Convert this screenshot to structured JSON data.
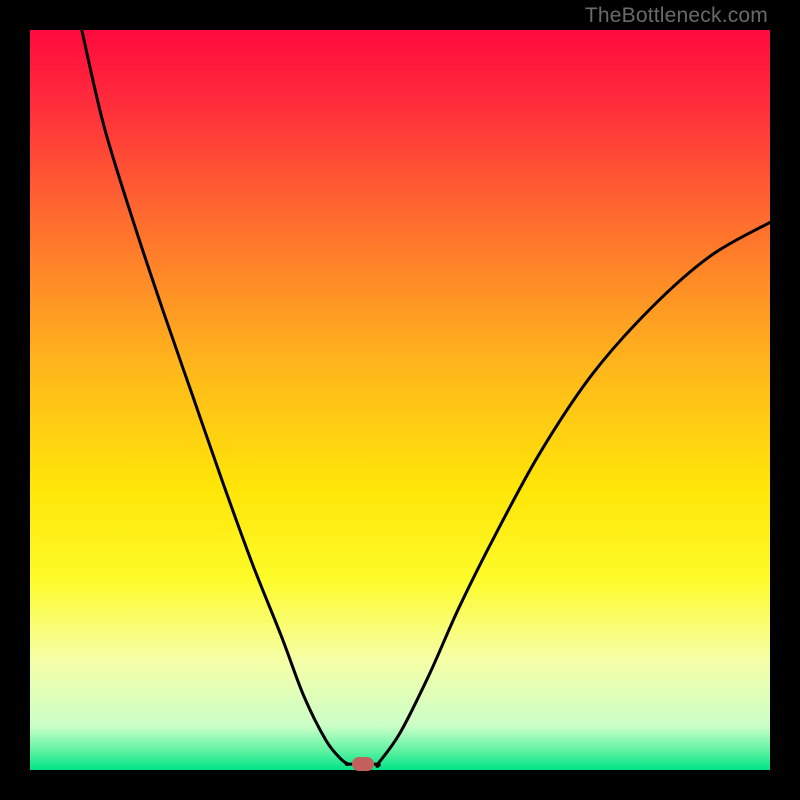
{
  "watermark": "TheBottleneck.com",
  "chart_data": {
    "type": "line",
    "title": "",
    "xlabel": "",
    "ylabel": "",
    "xlim": [
      0,
      100
    ],
    "ylim": [
      0,
      100
    ],
    "grid": false,
    "background_gradient": [
      {
        "stop": 0.0,
        "color": "#ff0a3e"
      },
      {
        "stop": 0.1,
        "color": "#ff2d3b"
      },
      {
        "stop": 0.25,
        "color": "#ff6a2f"
      },
      {
        "stop": 0.45,
        "color": "#ffb51c"
      },
      {
        "stop": 0.62,
        "color": "#ffe608"
      },
      {
        "stop": 0.74,
        "color": "#fdfb28"
      },
      {
        "stop": 0.85,
        "color": "#f6ffa6"
      },
      {
        "stop": 0.94,
        "color": "#ccffc8"
      },
      {
        "stop": 0.975,
        "color": "#5cf2a1"
      },
      {
        "stop": 1.0,
        "color": "#00e387"
      }
    ],
    "series": [
      {
        "name": "left-arm",
        "x": [
          7.0,
          10.0,
          14.0,
          18.0,
          22.0,
          26.0,
          30.0,
          34.0,
          37.0,
          40.0,
          42.0,
          43.0
        ],
        "y": [
          100.0,
          87.0,
          74.0,
          62.0,
          50.5,
          39.0,
          28.0,
          18.0,
          10.0,
          4.0,
          1.5,
          0.8
        ]
      },
      {
        "name": "flat-bottom",
        "x": [
          43.0,
          47.0
        ],
        "y": [
          0.8,
          0.8
        ]
      },
      {
        "name": "right-arm",
        "x": [
          47.0,
          50.0,
          54.0,
          58.0,
          63.0,
          69.0,
          76.0,
          84.0,
          92.0,
          100.0
        ],
        "y": [
          0.8,
          5.0,
          13.0,
          22.0,
          32.0,
          43.0,
          53.5,
          62.5,
          69.5,
          74.0
        ]
      }
    ],
    "marker": {
      "x": 45.0,
      "y": 0.8,
      "color": "#c3605e"
    }
  }
}
